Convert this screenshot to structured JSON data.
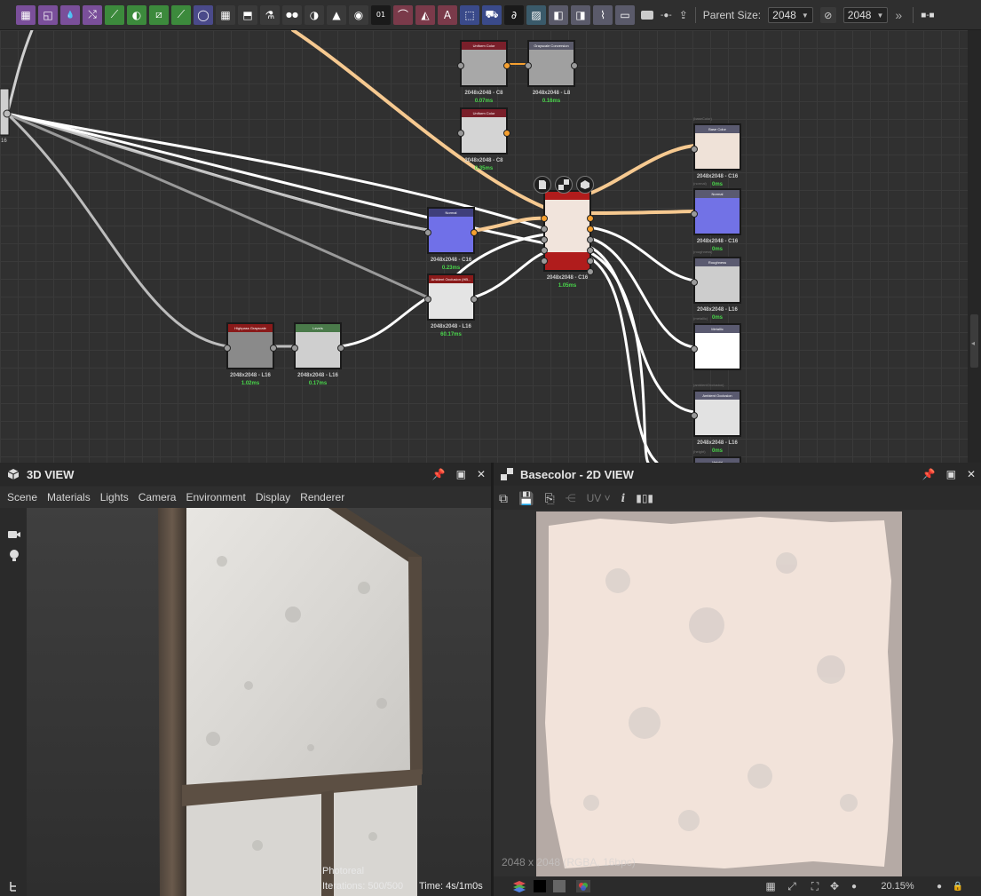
{
  "toolbar": {
    "parent_size_label": "Parent Size:",
    "parent_size_value": "2048",
    "output_size_value": "2048",
    "more_label": "»",
    "icons": [
      {
        "name": "bitmap-icon",
        "bg": "#7a4f9a",
        "glyph": "▦"
      },
      {
        "name": "svg-icon",
        "bg": "#7a4f9a",
        "glyph": "◱"
      },
      {
        "name": "text-icon",
        "bg": "#7a4f9a",
        "glyph": "💧"
      },
      {
        "name": "transform-icon",
        "bg": "#7a4f9a",
        "glyph": "⤭"
      },
      {
        "name": "curve-icon",
        "bg": "#3c8a3c",
        "glyph": "⟋"
      },
      {
        "name": "levels-icon",
        "bg": "#3c8a3c",
        "glyph": "◐"
      },
      {
        "name": "gradient-map-icon",
        "bg": "#3c8a3c",
        "glyph": "⧄"
      },
      {
        "name": "blend-icon",
        "bg": "#3c8a3c",
        "glyph": "⟋"
      },
      {
        "name": "blur-icon",
        "bg": "#4a4a8a",
        "glyph": "◯"
      },
      {
        "name": "sharpen-icon",
        "bg": "#3a3a3a",
        "glyph": "▦"
      },
      {
        "name": "fill-icon",
        "bg": "#3a3a3a",
        "glyph": "⬒"
      },
      {
        "name": "warp-icon",
        "bg": "#3a3a3a",
        "glyph": "⚗"
      },
      {
        "name": "motion-blur-icon",
        "bg": "#3a3a3a",
        "glyph": "●●"
      },
      {
        "name": "hsl-icon",
        "bg": "#3a3a3a",
        "glyph": "◑"
      },
      {
        "name": "histogram-icon",
        "bg": "#3a3a3a",
        "glyph": "▲"
      },
      {
        "name": "color-wheel-icon",
        "bg": "#3a3a3a",
        "glyph": "◉"
      },
      {
        "name": "noise-icon",
        "bg": "#1a1a1a",
        "glyph": "01"
      },
      {
        "name": "gradient-icon",
        "bg": "#7a3a4a",
        "glyph": "⌒"
      },
      {
        "name": "mirror-icon",
        "bg": "#7a3a4a",
        "glyph": "◭"
      },
      {
        "name": "text-tool-icon",
        "bg": "#7a3a4a",
        "glyph": "A"
      },
      {
        "name": "crop-icon",
        "bg": "#3a4a8a",
        "glyph": "⬚"
      },
      {
        "name": "paint-icon",
        "bg": "#3a4a8a",
        "glyph": "⛟"
      },
      {
        "name": "pixel-processor-icon",
        "bg": "#1a1a1a",
        "glyph": "∂"
      },
      {
        "name": "fx-map-icon",
        "bg": "#3a5a6a",
        "glyph": "▨"
      },
      {
        "name": "input-icon",
        "bg": "#5a5a6a",
        "glyph": "◧"
      },
      {
        "name": "output-icon",
        "bg": "#5a5a6a",
        "glyph": "◨"
      },
      {
        "name": "function-icon",
        "bg": "#5a5a6a",
        "glyph": "⌇"
      },
      {
        "name": "frame-icon",
        "bg": "#5a5a6a",
        "glyph": "▭"
      }
    ],
    "extra_icons": [
      {
        "name": "comment-icon",
        "glyph": "▬"
      },
      {
        "name": "pin-node-icon",
        "glyph": "-●-"
      },
      {
        "name": "export-icon",
        "glyph": "⇪"
      }
    ]
  },
  "graph": {
    "nodes": [
      {
        "id": "uniform1",
        "title": "Uniform Color",
        "head": "#7a1f2a",
        "fill": "#a8a8a8",
        "res": "2048x2048 - C8",
        "time": "0.07ms"
      },
      {
        "id": "gray_conv",
        "title": "Grayscale Conversion",
        "head": "#5a5a6a",
        "fill": "#a0a0a0",
        "res": "2048x2048 - L8",
        "time": "0.16ms"
      },
      {
        "id": "uniform2",
        "title": "Uniform Color",
        "head": "#7a1f2a",
        "fill": "#d4d4d4",
        "res": "2048x2048 - C8",
        "time": "0.35ms"
      },
      {
        "id": "normal",
        "title": "Normal",
        "head": "#3f3f7a",
        "fill": "#7070e8",
        "res": "2048x2048 - C16",
        "time": "0.23ms"
      },
      {
        "id": "ao_hbao",
        "title": "Ambient Occlusion (HB...",
        "head": "#8a1a1a",
        "fill": "#e4e4e4",
        "res": "2048x2048 - L16",
        "time": "60.17ms"
      },
      {
        "id": "highpass",
        "title": "Highpass Grayscale",
        "head": "#8a1a1a",
        "fill": "#8a8a8a",
        "res": "2048x2048 - L16",
        "time": "1.02ms"
      },
      {
        "id": "levels",
        "title": "Levels",
        "head": "#4a7a4a",
        "fill": "#cfcfcf",
        "res": "2048x2048 - L16",
        "time": "0.17ms"
      },
      {
        "id": "material",
        "title": "",
        "head": "#b01c1c",
        "fill": "#f1e4dc",
        "res": "2048x2048 - C16",
        "time": "1.05ms"
      },
      {
        "id": "out_base",
        "title": "Base Color",
        "head": "#5a5a70",
        "fill": "#efe2d8",
        "res": "2048x2048 - C16",
        "time": "0ms",
        "tag": "(baseColor)"
      },
      {
        "id": "out_normal",
        "title": "Normal",
        "head": "#5a5a70",
        "fill": "#7272e6",
        "res": "2048x2048 - C16",
        "time": "0ms",
        "tag": "(normal)"
      },
      {
        "id": "out_rough",
        "title": "Roughness",
        "head": "#5a5a70",
        "fill": "#cdcdcd",
        "res": "2048x2048 - L16",
        "time": "0ms",
        "tag": "(roughness)"
      },
      {
        "id": "out_metal",
        "title": "Metallic",
        "head": "#5a5a70",
        "fill": "#ffffff",
        "res": "",
        "time": "",
        "tag": "(metallic)"
      },
      {
        "id": "out_ao",
        "title": "Ambient Occlusion",
        "head": "#5a5a70",
        "fill": "#e2e2e2",
        "res": "2048x2048 - L16",
        "time": "0ms",
        "tag": "(ambientOcclusion)"
      },
      {
        "id": "out_height",
        "title": "Height",
        "head": "#5a5a70",
        "fill": "#bbbbbb",
        "res": "",
        "time": "",
        "tag": "(height)"
      }
    ],
    "left_stub_res": "16"
  },
  "panel3d": {
    "title": "3D VIEW",
    "menu": [
      "Scene",
      "Materials",
      "Lights",
      "Camera",
      "Environment",
      "Display",
      "Renderer"
    ],
    "render_mode": "Photoreal",
    "iterations": "Iterations: 500/500",
    "time": "Time: 4s/1m0s"
  },
  "panel2d": {
    "title": "Basecolor - 2D VIEW",
    "uv_label": "UV",
    "resolution_overlay": "2048 x 2048 (RGBA, 16bpc)",
    "zoom": "20.15%"
  }
}
